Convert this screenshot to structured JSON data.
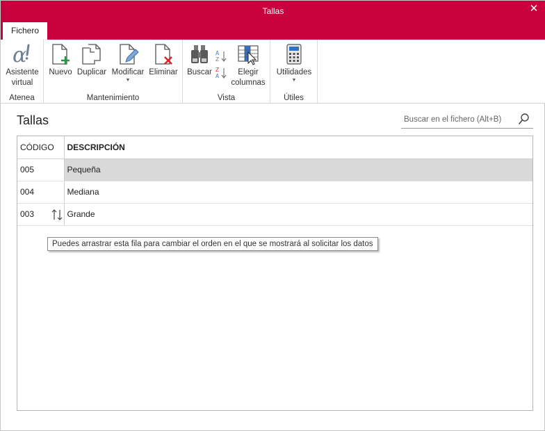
{
  "window": {
    "title": "Tallas",
    "accent_color": "#c8003c"
  },
  "ribbon": {
    "tab": "Fichero",
    "groups": [
      {
        "label": "Atenea",
        "buttons": [
          {
            "label": "Asistente\nvirtual",
            "icon": "alpha-icon"
          }
        ]
      },
      {
        "label": "Mantenimiento",
        "buttons": [
          {
            "label": "Nuevo",
            "icon": "new-file-icon"
          },
          {
            "label": "Duplicar",
            "icon": "duplicate-icon"
          },
          {
            "label": "Modificar",
            "icon": "edit-file-icon",
            "has_menu": true
          },
          {
            "label": "Eliminar",
            "icon": "delete-file-icon"
          }
        ]
      },
      {
        "label": "Vista",
        "buttons": [
          {
            "label": "Buscar",
            "icon": "binoculars-icon"
          },
          {
            "label": "",
            "icon": "sort-az-icon"
          },
          {
            "label": "",
            "icon": "sort-za-icon"
          },
          {
            "label": "Elegir\ncolumnas",
            "icon": "choose-columns-icon"
          }
        ]
      },
      {
        "label": "Útiles",
        "buttons": [
          {
            "label": "Utilidades",
            "icon": "calculator-icon",
            "has_menu": true
          }
        ]
      }
    ]
  },
  "content": {
    "title": "Tallas",
    "search_placeholder": "Buscar en el fichero (Alt+B)"
  },
  "grid": {
    "columns": [
      "CÓDIGO",
      "DESCRIPCIÓN"
    ],
    "rows": [
      {
        "code": "005",
        "description": "Pequeña",
        "selected": true
      },
      {
        "code": "004",
        "description": "Mediana",
        "selected": false
      },
      {
        "code": "003",
        "description": "Grande",
        "selected": false
      }
    ]
  },
  "tooltip": "Puedes arrastrar esta fila para cambiar el orden en el que se mostrará al solicitar los datos"
}
